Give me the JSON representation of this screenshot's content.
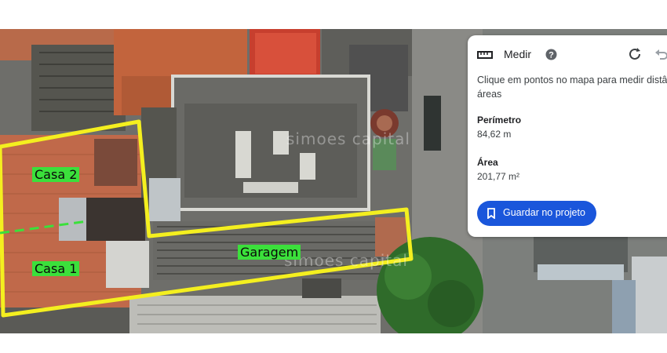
{
  "map": {
    "labels": {
      "casa2": "Casa 2",
      "casa1": "Casa 1",
      "garagem": "Garagem"
    },
    "watermark": "simoes capital",
    "colors": {
      "boundary": "#f4ef1f",
      "label_bg": "#3be03b",
      "divider": "#3be03b"
    }
  },
  "measure_panel": {
    "title": "Medir",
    "icons": [
      "ruler-icon",
      "help-icon",
      "refresh-icon",
      "undo-icon",
      "bookmark-icon"
    ],
    "hint": "Clique em pontos no mapa para medir distân áreas",
    "perimeter_label": "Perímetro",
    "perimeter_value": "84,62 m",
    "area_label": "Área",
    "area_value": "201,77 m²",
    "save_label": "Guardar no projeto",
    "accent_color": "#1a56db"
  }
}
